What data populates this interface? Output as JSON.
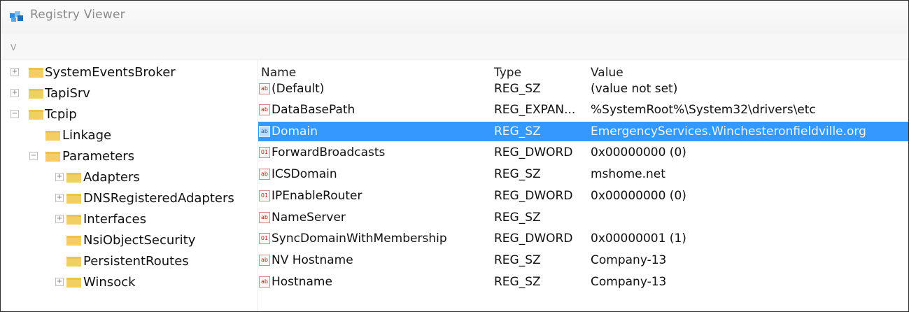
{
  "window": {
    "title": "Registry Viewer",
    "menu": "V"
  },
  "tree": [
    {
      "label": "SystemEventsBroker",
      "expander": "+"
    },
    {
      "label": "TapiSrv",
      "expander": "+"
    },
    {
      "label": "Tcpip",
      "expander": "−"
    },
    {
      "label": "Linkage",
      "expander": ""
    },
    {
      "label": "Parameters",
      "expander": "−"
    },
    {
      "label": "Adapters",
      "expander": "+"
    },
    {
      "label": "DNSRegisteredAdapters",
      "expander": "+"
    },
    {
      "label": "Interfaces",
      "expander": "+"
    },
    {
      "label": "NsiObjectSecurity",
      "expander": ""
    },
    {
      "label": "PersistentRoutes",
      "expander": ""
    },
    {
      "label": "Winsock",
      "expander": "+"
    }
  ],
  "list": {
    "columns": {
      "name": "Name",
      "type": "Type",
      "value": "Value"
    },
    "rows": [
      {
        "name": "(Default)",
        "type": "REG_SZ",
        "value": "(value not set)",
        "icon": "ab"
      },
      {
        "name": "DataBasePath",
        "type": "REG_EXPAN...",
        "value": "%SystemRoot%\\System32\\drivers\\etc",
        "icon": "ab"
      },
      {
        "name": "Domain",
        "type": "REG_SZ",
        "value": "EmergencyServices.Winchesteronfieldville.org",
        "icon": "ab"
      },
      {
        "name": "ForwardBroadcasts",
        "type": "REG_DWORD",
        "value": "0x00000000 (0)",
        "icon": "01"
      },
      {
        "name": "ICSDomain",
        "type": "REG_SZ",
        "value": "mshome.net",
        "icon": "ab"
      },
      {
        "name": "IPEnableRouter",
        "type": "REG_DWORD",
        "value": "0x00000000 (0)",
        "icon": "01"
      },
      {
        "name": "NameServer",
        "type": "REG_SZ",
        "value": "",
        "icon": "ab"
      },
      {
        "name": "SyncDomainWithMembership",
        "type": "REG_DWORD",
        "value": "0x00000001 (1)",
        "icon": "01"
      },
      {
        "name": "NV Hostname",
        "type": "REG_SZ",
        "value": "Company-13",
        "icon": "ab"
      },
      {
        "name": "Hostname",
        "type": "REG_SZ",
        "value": "Company-13",
        "icon": "ab"
      }
    ]
  }
}
